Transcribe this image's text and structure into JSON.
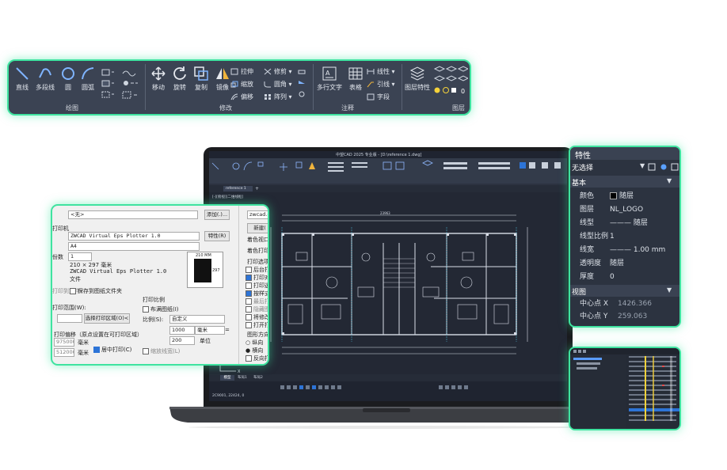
{
  "ribbon": {
    "draw": {
      "title": "绘图",
      "line": "直线",
      "polyline": "多段线",
      "circle": "圆",
      "arc": "圆弧"
    },
    "modify": {
      "title": "修改",
      "move": "移动",
      "rotate": "旋转",
      "copy": "复制",
      "mirror": "镜像",
      "stretch": "拉伸",
      "trim": "修剪",
      "scale": "缩放",
      "fillet": "圆角",
      "offset": "偏移",
      "array": "阵列"
    },
    "annotation": {
      "title": "注释",
      "mtext": "多行文字",
      "table": "表格",
      "linear": "线性",
      "leader": "引线",
      "text_style": "字段"
    },
    "layers": {
      "title": "图层",
      "layer_props": "图层特性",
      "current_layer": "0"
    }
  },
  "laptop": {
    "title": "中望CAD 2025 专业版 - [D:\\reference 1.dwg]",
    "tab_doc": "reference 1",
    "tab_plus": "+",
    "view_label": "[-][俯视][二维线框]",
    "layout_tabs": [
      "模型",
      "布局1",
      "布局2"
    ],
    "coords": "2C9001, 22424, 0",
    "dim_total": "23963"
  },
  "props": {
    "title": "特性",
    "selection": "无选择",
    "section_basic": "基本",
    "rows": [
      {
        "label": "颜色",
        "value": "随层"
      },
      {
        "label": "图层",
        "value": "NL_LOGO"
      },
      {
        "label": "线型",
        "value": "——— 随层"
      },
      {
        "label": "线型比例",
        "value": "1"
      },
      {
        "label": "线宽",
        "value": "——— 1.00 mm"
      },
      {
        "label": "透明度",
        "value": "随层"
      },
      {
        "label": "厚度",
        "value": "0"
      }
    ],
    "section_view": "视图",
    "view_rows": [
      {
        "label": "中心点 X",
        "value": "1426.366"
      },
      {
        "label": "中心点 Y",
        "value": "259.063"
      }
    ]
  },
  "plot": {
    "page_setup_value": "<无>",
    "add_button": "添加(.)...",
    "printer_label": "打印机",
    "printer_value": "ZWCAD Virtual Eps Plotter 1.0",
    "props_button": "特性(R)",
    "paper_value": "A4",
    "copies_label": "份数",
    "copies_value": "1",
    "paper_dims": "210 × 297  毫米",
    "plotter_name": "ZWCAD Virtual Eps Plotter 1.0",
    "location": "文件",
    "preview_w": "210 MM",
    "preview_h": "297",
    "print_to_file": "打印到文件",
    "save_file": "保存到图纸文件夹",
    "area_label": "打印范围(W):",
    "select_area": "选择打印区域(O)<",
    "offset_label": "打印偏移（原点设置在可打印区域）",
    "offset_x": "975000",
    "offset_y": "512000",
    "unit_mm": "毫米",
    "center_plot": "居中打印(C)",
    "scale_title": "打印比例",
    "fit_paper": "布满图纸(I)",
    "scale_label": "比例(S):",
    "scale_value": "自定义",
    "scale_num": "1000",
    "scale_den": "200",
    "scale_unit": "毫米",
    "unit_label": "单位",
    "lineweight_scale": "缩放线宽(L)",
    "right_combo": "zwcad.c",
    "right_btn": "新建(",
    "style_label": "着色视口选项",
    "shade_label": "着色打印",
    "opts_title": "打印选项",
    "opts": [
      "后台打印",
      "打印对象线",
      "打印透明度",
      "按样式打印",
      "最后打印图纸",
      "隐藏图纸对象",
      "将修改保存",
      "打开打印戳记"
    ],
    "orient_title": "图形方向",
    "orient": [
      "纵向",
      "横向",
      "反向打印"
    ]
  },
  "colors": {
    "accent": "#3fe3a0",
    "ribbon_bg": "#3b4353",
    "cad_bg": "#232834",
    "panel_bg": "#2c3340"
  }
}
